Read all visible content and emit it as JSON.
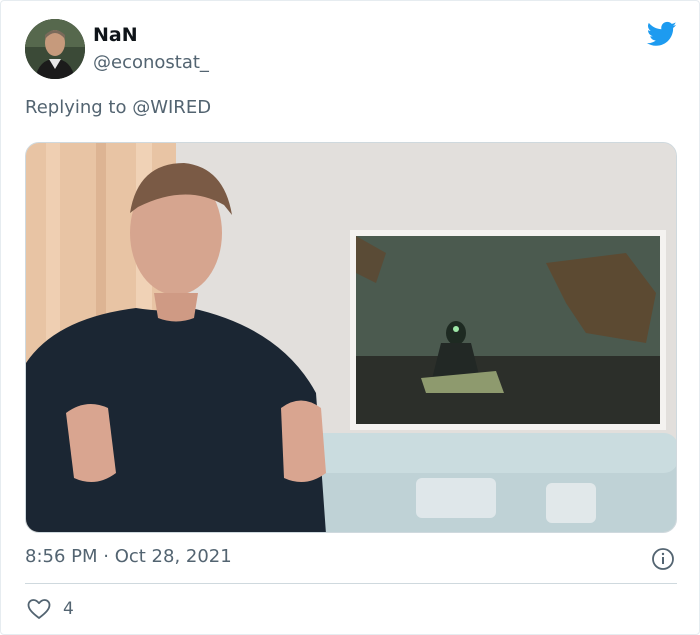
{
  "tweet": {
    "display_name": "NaN",
    "handle": "@econostat_",
    "reply_prefix": "Replying to ",
    "reply_to": "@WIRED",
    "timestamp": "8:56 PM · Oct 28, 2021",
    "likes": "4"
  },
  "icons": {
    "brand": "twitter-bird-icon",
    "info": "info-icon",
    "like": "heart-icon"
  },
  "colors": {
    "twitter_blue": "#1d9bf0",
    "secondary_text": "#536471",
    "primary_text": "#0f1419",
    "divider": "#cfd9de"
  }
}
